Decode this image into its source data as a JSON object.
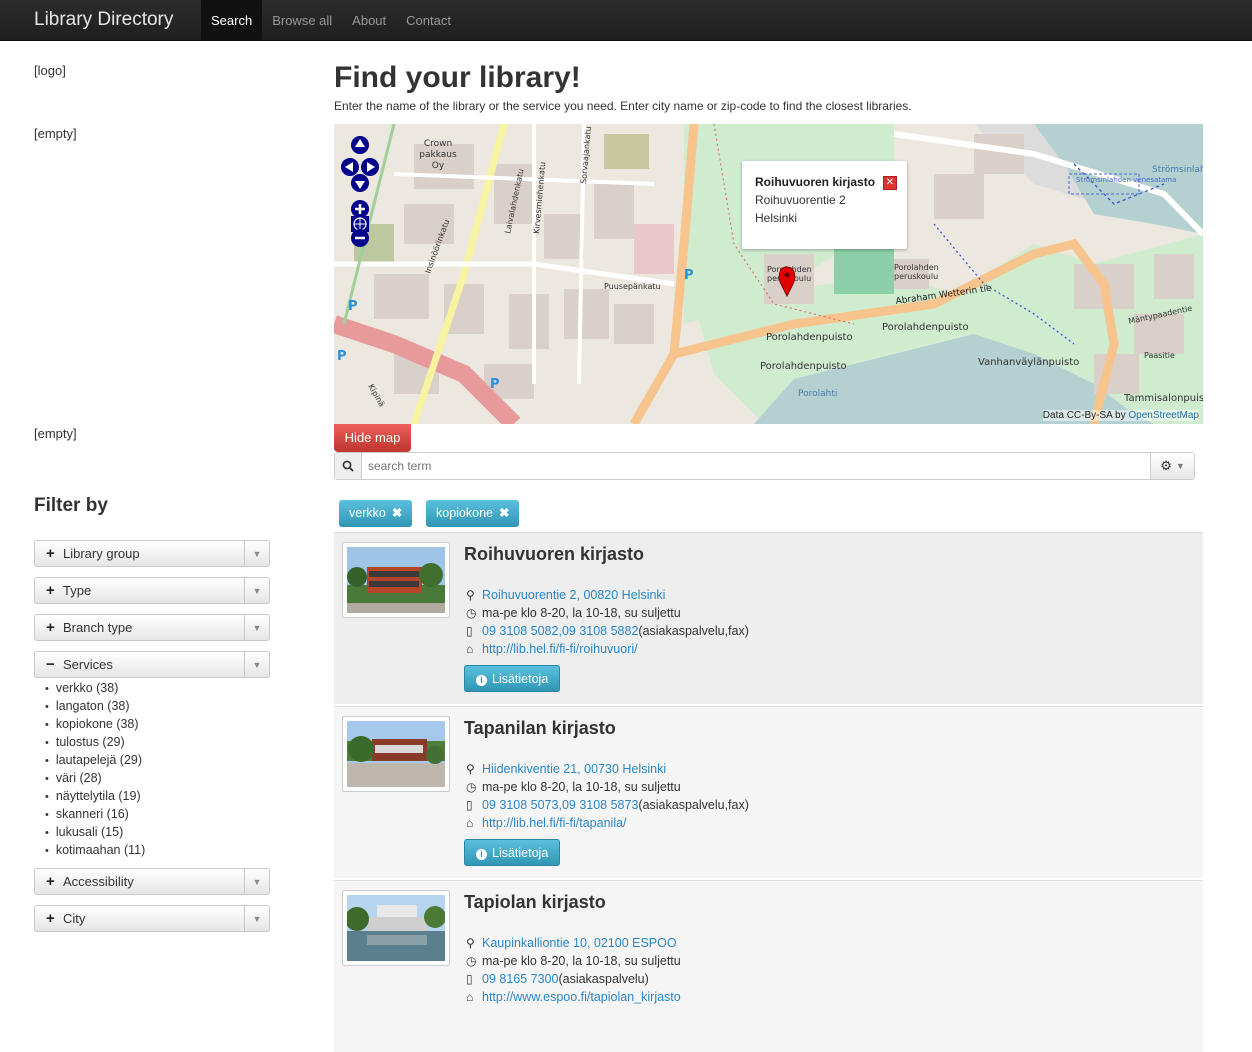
{
  "navbar": {
    "brand": "Library Directory",
    "items": [
      "Search",
      "Browse all",
      "About",
      "Contact"
    ],
    "active": "Search"
  },
  "sidebar": {
    "logo": "[logo]",
    "empty1": "[empty]",
    "empty2": "[empty]",
    "filter_title": "Filter by",
    "filters": [
      {
        "label": "Library group",
        "sign": "+"
      },
      {
        "label": "Type",
        "sign": "+"
      },
      {
        "label": "Branch type",
        "sign": "+"
      },
      {
        "label": "Services",
        "sign": "−"
      },
      {
        "label": "Accessibility",
        "sign": "+"
      },
      {
        "label": "City",
        "sign": "+"
      }
    ],
    "services": [
      "verkko (38)",
      "langaton (38)",
      "kopiokone (38)",
      "tulostus (29)",
      "lautapelejä (29)",
      "väri (28)",
      "näyttelytila (19)",
      "skanneri (16)",
      "lukusali (15)",
      "kotimaahan (11)"
    ]
  },
  "main": {
    "title": "Find your library!",
    "intro": "Enter the name of the library or the service you need. Enter city name or zip-code to find the closest libraries.",
    "map": {
      "popup_name": "Roihuvuoren kirjasto",
      "popup_street": "Roihuvuorentie 2",
      "popup_city": "Helsinki",
      "attribution_prefix": "Data CC-By-SA by ",
      "attribution_link": "OpenStreetMap",
      "labels": {
        "crown": "Crown",
        "pakkaus": "pakkaus",
        "oy": "Oy",
        "laivalahdenkatu": "Laivalahdenkatu",
        "kirvesmiehenkatu": "Kirvesmiehenkatu",
        "sorvaajankatu": "Sorvaajankatu",
        "puusepankatu": "Puusepänkatu",
        "insinoorinkatu": "Insinöörinkatu",
        "porolahden_peruskoulu": "Porolahden",
        "peruskoulu": "peruskoulu",
        "abraham": "Abraham Wetterin tie",
        "porolahdenpuisto": "Porolahdenpuisto",
        "vanhanvaylanpuisto": "Vanhanväylänpuisto",
        "tammisalonpuisto": "Tammisalonpuisto",
        "porolahti": "Porolahti",
        "mantypaadentie": "Mäntypaadentie",
        "paasitie": "Paasitie",
        "stromsinlahti": "Strömsinlahti",
        "veneasema": "Strömsinlahden venesatama",
        "kipina": "Kipinä"
      }
    },
    "hide_map": "Hide map",
    "search_placeholder": "search term",
    "tags": [
      "verkko",
      "kopiokone"
    ],
    "more_label": "Lisätietoja",
    "results": [
      {
        "name": "Roihuvuoren kirjasto",
        "address": "Roihuvuorentie 2, 00820 Helsinki",
        "hours": "ma-pe klo 8-20, la 10-18, su suljettu",
        "phones": "09 3108 5082,09 3108 5882",
        "phone_note": " (asiakaspalvelu,fax)",
        "url": "http://lib.hel.fi/fi-fi/roihuvuori/"
      },
      {
        "name": "Tapanilan kirjasto",
        "address": "Hiidenkiventie 21, 00730 Helsinki",
        "hours": "ma-pe klo 8-20, la 10-18, su suljettu",
        "phones": "09 3108 5073,09 3108 5873",
        "phone_note": " (asiakaspalvelu,fax)",
        "url": "http://lib.hel.fi/fi-fi/tapanila/"
      },
      {
        "name": "Tapiolan kirjasto",
        "address": "Kaupinkalliontie 10, 02100 ESPOO",
        "hours": "ma-pe klo 8-20, la 10-18, su suljettu",
        "phones": "09 8165 7300",
        "phone_note": " (asiakaspalvelu)",
        "url": "http://www.espoo.fi/tapiolan_kirjasto"
      }
    ]
  },
  "colors": {
    "navbar": "#222222",
    "info_button": "#2f96b4",
    "danger_button": "#bd362f",
    "link": "#2a86c8"
  }
}
